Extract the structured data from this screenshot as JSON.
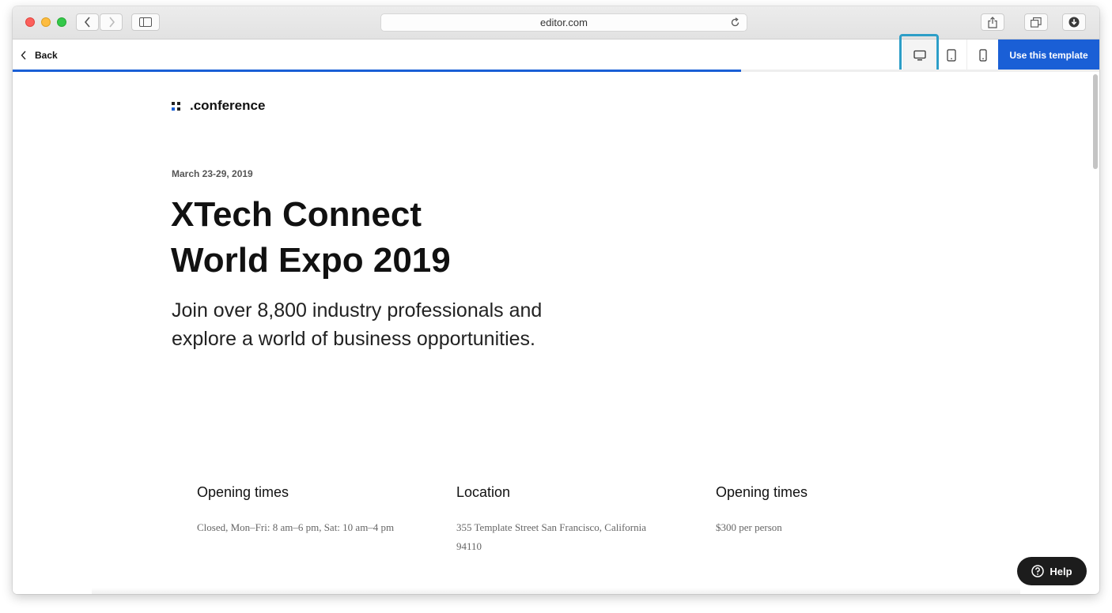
{
  "browser": {
    "url": "editor.com"
  },
  "app": {
    "back_label": "Back",
    "use_template_label": "Use this template",
    "progress": 0.67,
    "accent_color": "#1a5fd6",
    "devices": [
      "desktop-icon",
      "tablet-icon",
      "mobile-icon"
    ],
    "selected_device": "desktop"
  },
  "page": {
    "logo_text": ".conference",
    "date": "March 23-29, 2019",
    "title_line1": "XTech Connect",
    "title_line2": "World Expo 2019",
    "subtitle": "Join over 8,800 industry professionals and explore a world of business opportunities.",
    "info": [
      {
        "heading": "Opening times",
        "text": "Closed, Mon–Fri: 8 am–6 pm, Sat: 10 am–4 pm"
      },
      {
        "heading": "Location",
        "text": "355 Template Street San Francisco, California 94110"
      },
      {
        "heading": "Opening times",
        "text": "$300 per person"
      }
    ]
  },
  "help": {
    "label": "Help"
  }
}
